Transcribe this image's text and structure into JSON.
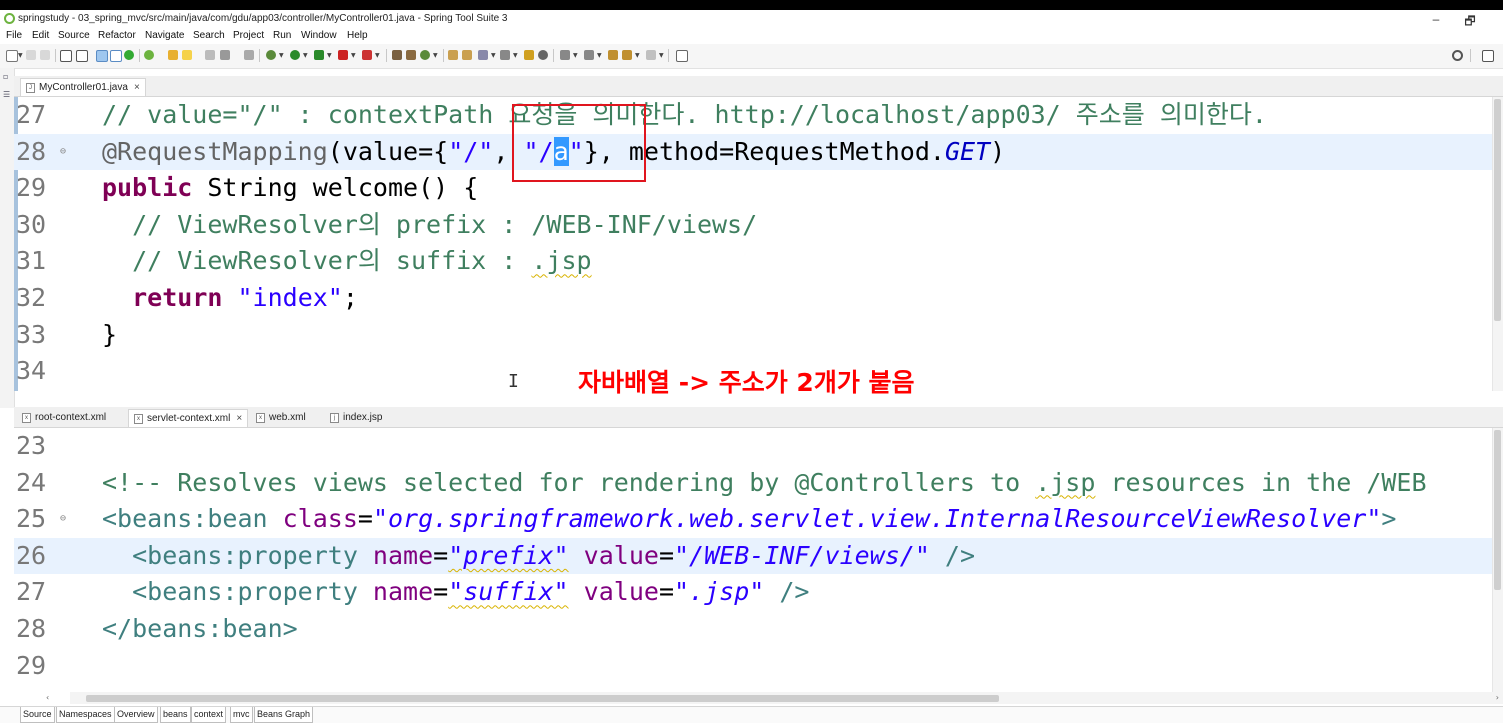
{
  "window": {
    "title": "springstudy - 03_spring_mvc/src/main/java/com/gdu/app03/controller/MyController01.java - Spring Tool Suite 3",
    "minimize": "–",
    "restore": "🗗"
  },
  "menu": [
    "File",
    "Edit",
    "Source",
    "Refactor",
    "Navigate",
    "Search",
    "Project",
    "Run",
    "Window",
    "Help"
  ],
  "top_editor": {
    "tab_label": "MyController01.java",
    "lines": [
      {
        "num": "27",
        "segments": [
          {
            "t": "// value=\"/\" : contextPath 요청을 의미한다. http://localhost/app03/ 주소를 의미한다.",
            "c": "cmt"
          }
        ]
      },
      {
        "num": "28",
        "segments": [
          {
            "t": "@RequestMapping",
            "c": "ann"
          },
          {
            "t": "(value={",
            "c": "plain"
          },
          {
            "t": "\"/\"",
            "c": "str"
          },
          {
            "t": ", ",
            "c": "plain"
          },
          {
            "t": "\"/",
            "c": "str"
          },
          {
            "t": "a",
            "c": "sel"
          },
          {
            "t": "\"",
            "c": "str"
          },
          {
            "t": "}, method=RequestMethod.",
            "c": "plain"
          },
          {
            "t": "GET",
            "c": "ital"
          },
          {
            "t": ")",
            "c": "plain"
          }
        ]
      },
      {
        "num": "29",
        "segments": [
          {
            "t": "public",
            "c": "kw"
          },
          {
            "t": " String welcome() {",
            "c": "plain"
          }
        ]
      },
      {
        "num": "30",
        "segments": [
          {
            "t": "  // ViewResolver의 prefix : /WEB-INF/views/",
            "c": "cmt"
          }
        ]
      },
      {
        "num": "31",
        "segments": [
          {
            "t": "  // ViewResolver의 suffix : ",
            "c": "cmt"
          },
          {
            "t": ".jsp",
            "c": "cmt wavy"
          }
        ]
      },
      {
        "num": "32",
        "segments": [
          {
            "t": "  ",
            "c": "plain"
          },
          {
            "t": "return",
            "c": "kw"
          },
          {
            "t": " ",
            "c": "plain"
          },
          {
            "t": "\"index\"",
            "c": "str"
          },
          {
            "t": ";",
            "c": "plain"
          }
        ]
      },
      {
        "num": "33",
        "segments": [
          {
            "t": "}",
            "c": "plain"
          }
        ]
      },
      {
        "num": "34",
        "segments": [
          {
            "t": "",
            "c": "plain"
          }
        ]
      }
    ],
    "annotation_note": "자바배열 -> 주소가 2개가 붙음"
  },
  "bottom_editor": {
    "tabs": [
      "root-context.xml",
      "servlet-context.xml",
      "web.xml",
      "index.jsp"
    ],
    "lines": [
      {
        "num": "23",
        "segments": [
          {
            "t": "",
            "c": "plain"
          }
        ]
      },
      {
        "num": "24",
        "segments": [
          {
            "t": "<!-- Resolves views selected for rendering by @Controllers to ",
            "c": "cmt"
          },
          {
            "t": ".jsp",
            "c": "cmt wavy"
          },
          {
            "t": " resources in the /WEB",
            "c": "cmt"
          }
        ]
      },
      {
        "num": "25",
        "segments": [
          {
            "t": "<beans:bean",
            "c": "xmltag"
          },
          {
            "t": " class",
            "c": "xmlattr"
          },
          {
            "t": "=",
            "c": "plain"
          },
          {
            "t": "\"org.springframework.web.servlet.view.InternalResourceViewResolver\"",
            "c": "xmlval"
          },
          {
            "t": ">",
            "c": "xmltag"
          }
        ]
      },
      {
        "num": "26",
        "segments": [
          {
            "t": "  <beans:property",
            "c": "xmltag"
          },
          {
            "t": " name",
            "c": "xmlattr"
          },
          {
            "t": "=",
            "c": "plain"
          },
          {
            "t": "\"prefix\"",
            "c": "xmlval wavy"
          },
          {
            "t": " value",
            "c": "xmlattr"
          },
          {
            "t": "=",
            "c": "plain"
          },
          {
            "t": "\"/WEB-INF/views/\"",
            "c": "xmlval"
          },
          {
            "t": " />",
            "c": "xmltag"
          }
        ]
      },
      {
        "num": "27",
        "segments": [
          {
            "t": "  <beans:property",
            "c": "xmltag"
          },
          {
            "t": " name",
            "c": "xmlattr"
          },
          {
            "t": "=",
            "c": "plain"
          },
          {
            "t": "\"suffix\"",
            "c": "xmlval wavy"
          },
          {
            "t": " value",
            "c": "xmlattr"
          },
          {
            "t": "=",
            "c": "plain"
          },
          {
            "t": "\".jsp\"",
            "c": "xmlval"
          },
          {
            "t": " />",
            "c": "xmltag"
          }
        ]
      },
      {
        "num": "28",
        "segments": [
          {
            "t": "</beans:bean>",
            "c": "xmltag"
          }
        ]
      },
      {
        "num": "29",
        "segments": [
          {
            "t": "",
            "c": "plain"
          }
        ]
      }
    ],
    "bottom_tabs": [
      "Source",
      "Namespaces",
      "Overview",
      "beans",
      "context",
      "mvc",
      "Beans Graph"
    ]
  }
}
